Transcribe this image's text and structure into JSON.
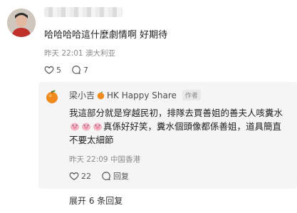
{
  "comment": {
    "text": "哈哈哈哈這什麼劇情啊 好期待",
    "time": "昨天 22:01",
    "location": "澳大利亚",
    "likes": "5",
    "replies": "7"
  },
  "reply": {
    "username": "梁小吉",
    "brand": "HK Happy Share",
    "author_badge": "作者",
    "text_1": "我這部分就是穿越民初，排隊去買善姐的善夫人咳糞水",
    "text_2": "真係好好笑，糞水個頭像都係善姐，道具簡直不要太細節",
    "time": "昨天 22:09",
    "location": "中国香港",
    "likes": "22",
    "reply_label": "回复"
  },
  "expand_label": "展开 6 条回复",
  "icons": [
    "heart-icon",
    "comment-icon",
    "orange-icon",
    "pig-emoji"
  ]
}
